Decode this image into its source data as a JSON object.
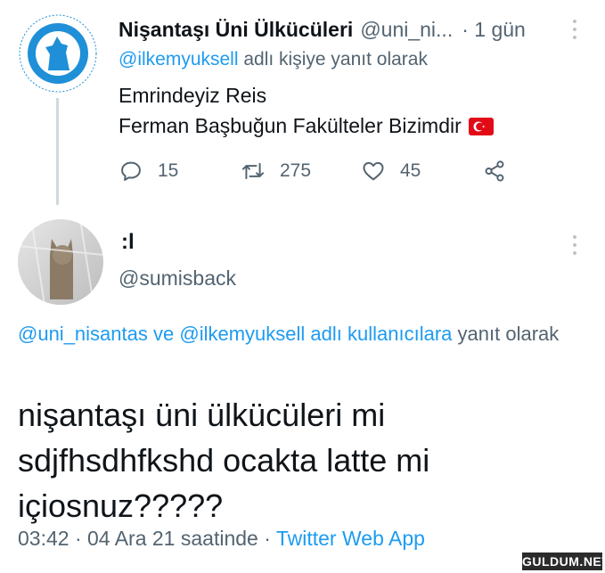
{
  "tweet1": {
    "name": "Nişantaşı Üni Ülkücüleri",
    "handle": "@uni_ni...",
    "time": "· 1 gün",
    "reply_to_mention": "@ilkemyuksell",
    "reply_suffix": "adlı kişiye yanıt olarak",
    "line1": "Emrindeyiz Reis",
    "line2": "Ferman Başbuğun Fakülteler Bizimdir",
    "avatar": {
      "icon": "wolf-emblem-logo",
      "accent": "#1f8fd8"
    },
    "actions": {
      "reply_count": "15",
      "retweet_count": "275",
      "like_count": "45"
    }
  },
  "tweet2": {
    "name": ":l",
    "handle": "@sumisback",
    "reply_mention_1": "@uni_nisantas",
    "reply_and": "ve",
    "reply_mention_2": "@ilkemyuksell",
    "reply_label": "adlı kullanıcılara",
    "reply_suffix": "yanıt olarak",
    "body_line1": "nişantaşı üni ülkücüleri mi",
    "body_line2": "sdjfhsdhfkshd ocakta latte mi",
    "body_line3": "içiosnuz?????",
    "time": "03:42 · 04 Ara 21 saatinde ·",
    "source": "Twitter Web App"
  },
  "watermark": "GULDUM.NET",
  "colors": {
    "link": "#1d9bf0",
    "muted": "#536471",
    "text": "#0f1419",
    "flag_red": "#e30a17"
  }
}
